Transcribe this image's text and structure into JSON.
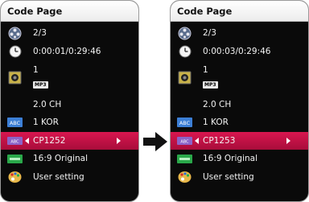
{
  "left": {
    "title": "Code Page",
    "title_text": "2/3",
    "time": "0:00:01/0:29:46",
    "audio_track": "1",
    "audio_format": "MP3",
    "audio_channels": "2.0 CH",
    "subtitle_language": "1 KOR",
    "code_page": "CP1252",
    "aspect": "16:9 Original",
    "picture_mode": "User setting"
  },
  "right": {
    "title": "Code Page",
    "title_text": "2/3",
    "time": "0:00:03/0:29:46",
    "audio_track": "1",
    "audio_format": "MP3",
    "audio_channels": "2.0 CH",
    "subtitle_language": "1 KOR",
    "code_page": "CP1253",
    "aspect": "16:9 Original",
    "picture_mode": "User setting"
  },
  "icons": {
    "abc_label": "ABC",
    "abc_small_label": "ABC"
  },
  "colors": {
    "selected": "#c0124a",
    "panel_bg": "#0a0a0a"
  }
}
